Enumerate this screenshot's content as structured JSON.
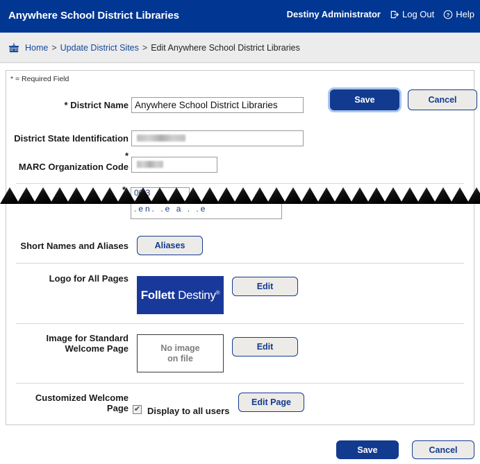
{
  "header": {
    "title": "Anywhere School District Libraries",
    "user": "Destiny Administrator",
    "logout_label": "Log Out",
    "logout_icon": "logout-icon",
    "help_label": "Help",
    "help_icon": "help-circle-icon",
    "background_color": "#013792"
  },
  "breadcrumb": {
    "icon": "school-building-icon",
    "home": "Home",
    "sep1": ">",
    "update_sites": "Update District Sites",
    "sep2": ">",
    "current": "Edit Anywhere School District Libraries"
  },
  "form": {
    "required_note": "* = Required Field",
    "district_name": {
      "label": "District Name",
      "star": "*",
      "value": "Anywhere School District Libraries"
    },
    "district_state_id": {
      "label": "District State Identification",
      "value": ""
    },
    "marc_org_code": {
      "label": "MARC Organization Code",
      "star": "*",
      "value": ""
    },
    "torn_field": {
      "star": "*",
      "top_value": "06 3",
      "bottom_value": ".en. .e   a . .e"
    },
    "short_names": {
      "label": "Short Names and Aliases",
      "button": "Aliases"
    },
    "logo": {
      "label": "Logo for All Pages",
      "logo_bold": "Follett",
      "logo_light": "Destiny",
      "logo_mark": "®",
      "edit_button": "Edit"
    },
    "standard_welcome_image": {
      "label_line1": "Image for Standard",
      "label_line2": "Welcome Page",
      "placeholder_line1": "No image",
      "placeholder_line2": "on file",
      "edit_button": "Edit"
    },
    "customized_welcome": {
      "label_line1": "Customized Welcome",
      "label_line2": "Page",
      "checkbox_checked": true,
      "checkbox_label": "Display to all users",
      "edit_button": "Edit Page"
    }
  },
  "actions": {
    "save_top": "Save",
    "cancel_top": "Cancel",
    "save_bottom": "Save",
    "cancel_bottom": "Cancel"
  },
  "colors": {
    "brand_blue": "#013792",
    "button_blue": "#123a8f",
    "link_blue": "#14479b",
    "panel_border": "#c9c9c9"
  }
}
